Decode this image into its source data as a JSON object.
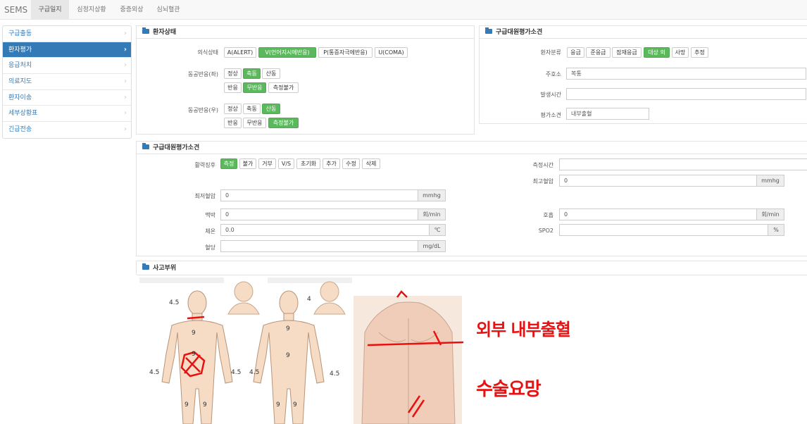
{
  "nav": {
    "brand": "SEMS",
    "tabs": [
      "구급일지",
      "심정지상황",
      "중증외상",
      "심뇌혈관"
    ]
  },
  "sidebar": {
    "items": [
      {
        "label": "구급출동"
      },
      {
        "label": "환자평가"
      },
      {
        "label": "응급처치"
      },
      {
        "label": "의료지도"
      },
      {
        "label": "환자이송"
      },
      {
        "label": "세부상황표"
      },
      {
        "label": "긴급전송"
      }
    ],
    "active_index": 1
  },
  "patient_state": {
    "title": "환자상태",
    "consciousness": {
      "label": "의식상태",
      "options": [
        "A(ALERT)",
        "V(언어지시에반응)",
        "P(통증자극에반응)",
        "U(COMA)"
      ],
      "selected": "V(언어지시에반응)"
    },
    "pupil_left": {
      "label": "동공반응(좌)",
      "row1": [
        "정상",
        "축동",
        "산동"
      ],
      "row2": [
        "반응",
        "무반응",
        "측정불가"
      ],
      "selected": [
        "축동",
        "무반응"
      ]
    },
    "pupil_right": {
      "label": "동공반응(우)",
      "row1": [
        "정상",
        "축동",
        "산동"
      ],
      "row2": [
        "반응",
        "무반응",
        "측정불가"
      ],
      "selected": [
        "산동",
        "측정불가"
      ]
    }
  },
  "assessment_top": {
    "title": "구급대원평가소견",
    "patient_class": {
      "label": "환자분류",
      "options": [
        "응급",
        "준응급",
        "잠재응급",
        "대상 외",
        "사망",
        "추정"
      ],
      "selected": "대상 외"
    },
    "chief_complaint": {
      "label": "주호소",
      "value": "복통"
    },
    "onset_time": {
      "label": "발생시간",
      "value": ""
    },
    "assessment": {
      "label": "평가소견",
      "value": "내부출혈"
    }
  },
  "vitals": {
    "title": "구급대원평가소견",
    "vital_signs": {
      "label": "활력징후",
      "buttons": [
        "측정",
        "불가",
        "거부",
        "V/S",
        "초기화",
        "추가",
        "수정",
        "삭제"
      ],
      "selected": "측정"
    },
    "measure_time": {
      "label": "측정시간",
      "value": ""
    },
    "systolic": {
      "label": "최고혈압",
      "value": "0",
      "unit": "mmhg"
    },
    "diastolic": {
      "label": "최저혈압",
      "value": "0",
      "unit": "mmhg"
    },
    "pulse": {
      "label": "맥박",
      "value": "0",
      "unit": "회/min"
    },
    "respiration": {
      "label": "호흡",
      "value": "0",
      "unit": "회/min"
    },
    "temperature": {
      "label": "체온",
      "value": "0.0",
      "unit": "℃"
    },
    "spo2": {
      "label": "SPO2",
      "value": "",
      "unit": "%"
    },
    "glucose": {
      "label": "혈당",
      "value": "",
      "unit": "mg/dL"
    }
  },
  "injury": {
    "title": "사고부위",
    "front_numbers": [
      "4.5",
      "9",
      "9",
      "4.5",
      "4.5",
      "9",
      "9"
    ],
    "back_numbers": [
      "4",
      "9",
      "9",
      "4.5",
      "4.5",
      "9",
      "9"
    ],
    "handwriting_line1": "외부 내부출혈",
    "handwriting_line2": "수술요망"
  },
  "colors": {
    "primary": "#337ab7",
    "selected": "#5cb85c",
    "skin": "#f6dcc4",
    "ink": "#e81010"
  }
}
